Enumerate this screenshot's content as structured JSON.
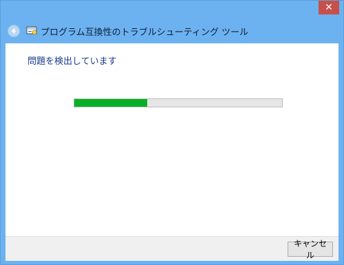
{
  "window": {
    "title": "プログラム互換性のトラブルシューティング ツール",
    "close_icon": "close-icon",
    "back_icon": "back-arrow-icon",
    "app_icon": "troubleshooter-icon"
  },
  "content": {
    "status_text": "問題を検出しています",
    "progress_value": 0.35
  },
  "footer": {
    "cancel_label": "キャンセル"
  },
  "colors": {
    "title_bar": "#6cb2f0",
    "progress_fill": "#07b025",
    "close_button": "#c7504b",
    "heading_text": "#1a3a8a"
  }
}
